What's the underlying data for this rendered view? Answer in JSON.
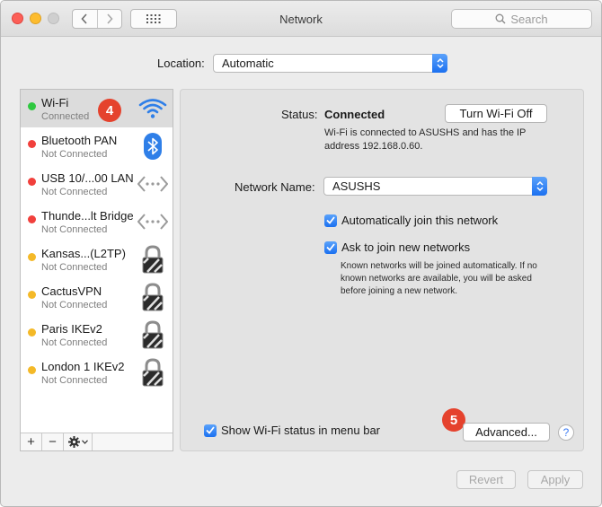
{
  "window": {
    "title": "Network",
    "search_placeholder": "Search"
  },
  "location": {
    "label": "Location:",
    "value": "Automatic"
  },
  "services": [
    {
      "name": "Wi-Fi",
      "status": "Connected",
      "dot": "#2fc840",
      "icon": "wifi-icon"
    },
    {
      "name": "Bluetooth PAN",
      "status": "Not Connected",
      "dot": "#f1403c",
      "icon": "bluetooth-icon"
    },
    {
      "name": "USB 10/...00 LAN",
      "status": "Not Connected",
      "dot": "#f1403c",
      "icon": "ethernet-icon"
    },
    {
      "name": "Thunde...lt Bridge",
      "status": "Not Connected",
      "dot": "#f1403c",
      "icon": "ethernet-icon"
    },
    {
      "name": "Kansas...(L2TP)",
      "status": "Not Connected",
      "dot": "#f4b928",
      "icon": "vpn-lock-icon"
    },
    {
      "name": "CactusVPN",
      "status": "Not Connected",
      "dot": "#f4b928",
      "icon": "vpn-lock-icon"
    },
    {
      "name": "Paris IKEv2",
      "status": "Not Connected",
      "dot": "#f4b928",
      "icon": "vpn-lock-icon"
    },
    {
      "name": "London 1 IKEv2",
      "status": "Not Connected",
      "dot": "#f4b928",
      "icon": "vpn-lock-icon"
    }
  ],
  "sidebar_bar": {
    "add": "+",
    "remove": "−"
  },
  "badges": {
    "step4": "4",
    "step5": "5"
  },
  "detail": {
    "status_label": "Status:",
    "status_value": "Connected",
    "toggle_button": "Turn Wi-Fi Off",
    "status_description": "Wi-Fi is connected to ASUSHS and has the IP address 192.168.0.60.",
    "network_name_label": "Network Name:",
    "network_name_value": "ASUSHS",
    "auto_join_label": "Automatically join this network",
    "ask_join_label": "Ask to join new networks",
    "ask_join_note": "Known networks will be joined automatically. If no known networks are available, you will be asked before joining a new network.",
    "show_status_label": "Show Wi-Fi status in menu bar",
    "advanced_button": "Advanced...",
    "help": "?"
  },
  "footer": {
    "revert": "Revert",
    "apply": "Apply"
  },
  "colors": {
    "accent": "#1b70f0",
    "badge": "#e5422d"
  }
}
